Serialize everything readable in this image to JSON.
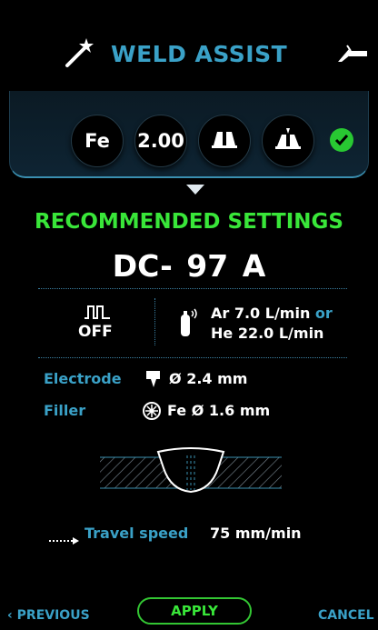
{
  "header": {
    "title": "WELD ASSIST"
  },
  "params": {
    "material": "Fe",
    "thickness": "2.00"
  },
  "recommended": {
    "heading": "RECOMMENDED SETTINGS",
    "current": "DC- 97 A"
  },
  "pulse": {
    "state": "OFF"
  },
  "gas": {
    "line1_gas": "Ar 7.0 L/min",
    "or": "or",
    "line2": "He 22.0 L/min"
  },
  "electrode": {
    "label": "Electrode",
    "symbol": "Ø",
    "value": "2.4 mm"
  },
  "filler": {
    "label": "Filler",
    "material": "Fe",
    "symbol": "Ø",
    "value": "1.6 mm"
  },
  "travel": {
    "label": "Travel speed",
    "value": "75 mm/min"
  },
  "footer": {
    "previous": "PREVIOUS",
    "apply": "APPLY",
    "cancel": "CANCEL"
  },
  "colors": {
    "accent": "#3aa1c7",
    "success": "#39e639",
    "background": "#000000"
  }
}
